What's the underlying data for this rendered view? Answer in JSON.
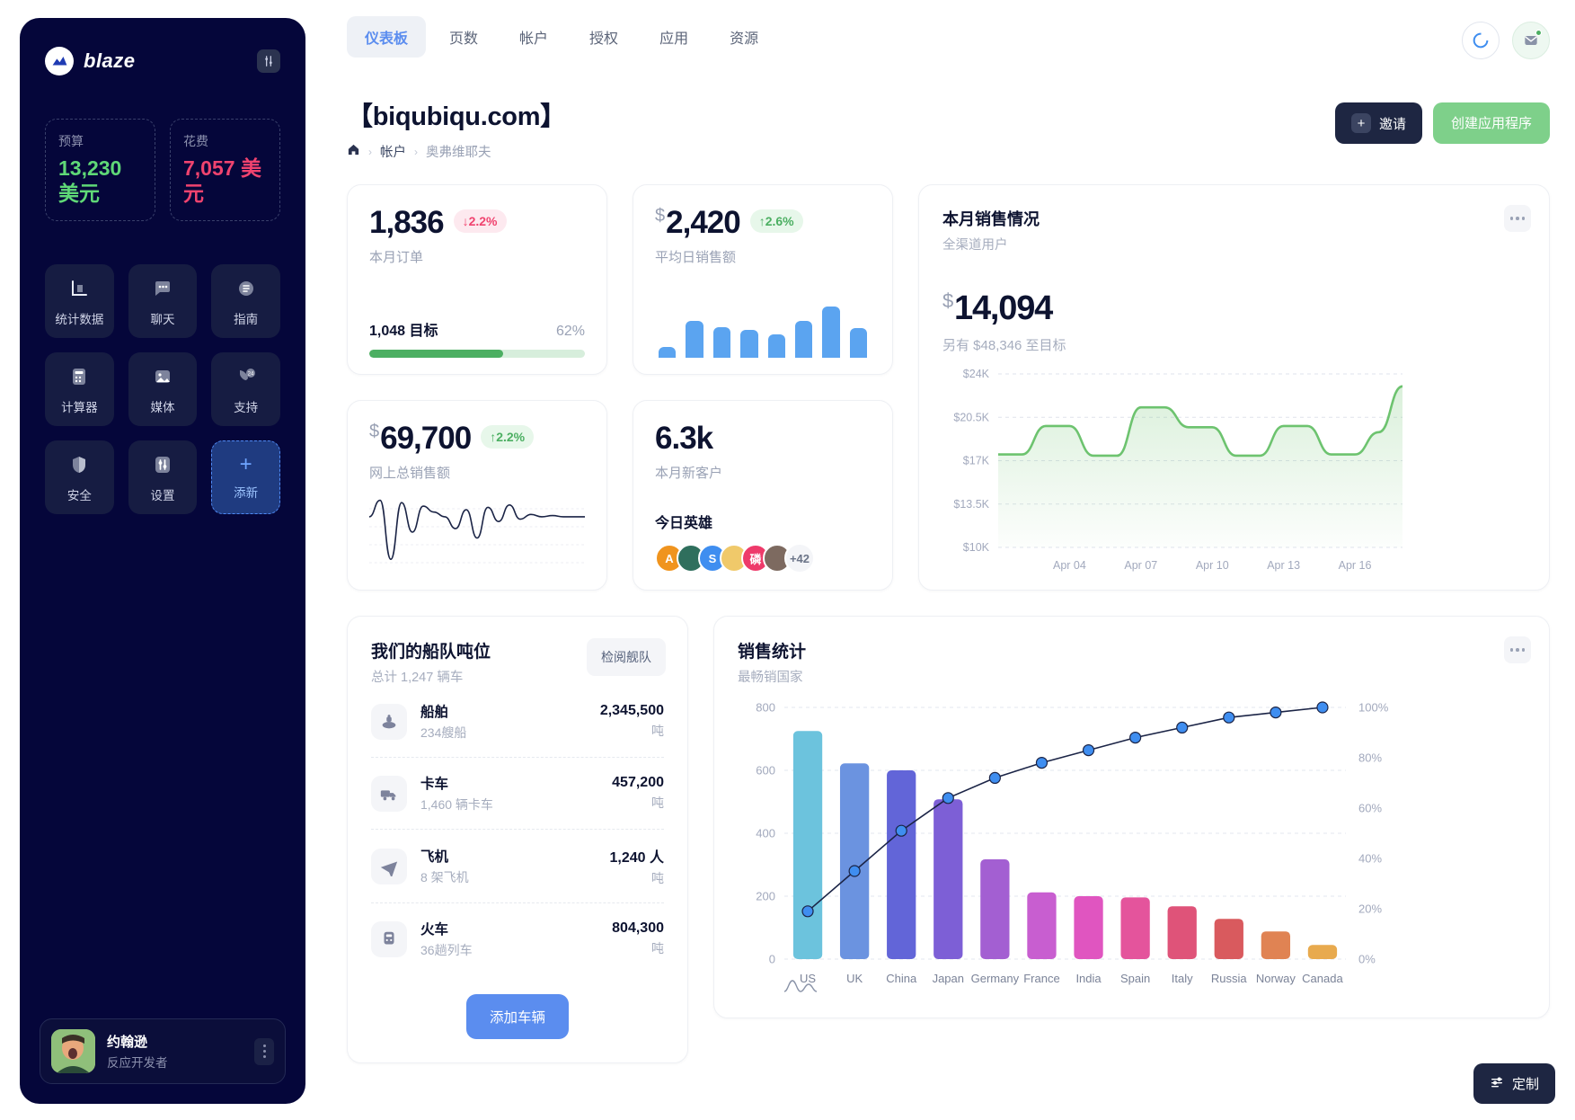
{
  "sidebar": {
    "brand": "blaze",
    "settings_icon": "sliders-icon",
    "budget": {
      "label": "预算",
      "value": "13,230 美元",
      "color": "#5fd877"
    },
    "spend": {
      "label": "花费",
      "value": "7,057 美元",
      "color": "#f0436f"
    },
    "nav": [
      {
        "label": "统计数据",
        "icon": "chart-icon"
      },
      {
        "label": "聊天",
        "icon": "chat-icon"
      },
      {
        "label": "指南",
        "icon": "guide-icon"
      },
      {
        "label": "计算器",
        "icon": "calculator-icon"
      },
      {
        "label": "媒体",
        "icon": "media-icon"
      },
      {
        "label": "支持",
        "icon": "support-24-icon"
      },
      {
        "label": "安全",
        "icon": "shield-icon"
      },
      {
        "label": "设置",
        "icon": "settings-icon"
      },
      {
        "label": "添新",
        "icon": "plus-icon"
      }
    ],
    "profile": {
      "name": "约翰逊",
      "role": "反应开发者"
    }
  },
  "header": {
    "tabs": [
      {
        "label": "仪表板",
        "active": true
      },
      {
        "label": "页数",
        "active": false
      },
      {
        "label": "帐户",
        "active": false
      },
      {
        "label": "授权",
        "active": false
      },
      {
        "label": "应用",
        "active": false
      },
      {
        "label": "资源",
        "active": false
      }
    ],
    "title": "【biqubiqu.com】",
    "breadcrumb": {
      "home": "home-icon",
      "level1": "帐户",
      "level2": "奥弗维耶夫"
    },
    "invite_button": "邀请",
    "create_button": "创建应用程序"
  },
  "cards": {
    "orders": {
      "value": "1,836",
      "change": "2.2%",
      "direction": "down",
      "subtitle": "本月订单",
      "goal_label": "1,048 目标",
      "goal_percent": "62%",
      "goal_fill": 62
    },
    "avg_daily": {
      "currency": "$",
      "value": "2,420",
      "change": "2.6%",
      "direction": "up",
      "subtitle": "平均日销售额"
    },
    "online_sales": {
      "currency": "$",
      "value": "69,700",
      "change": "2.2%",
      "direction": "up",
      "subtitle": "网上总销售额"
    },
    "new_customers": {
      "value": "6.3k",
      "subtitle": "本月新客户",
      "heroes_label": "今日英雄",
      "heroes": [
        {
          "initial": "A",
          "color": "#f0941e"
        },
        {
          "initial": "",
          "color": "#2f6f5d"
        },
        {
          "initial": "S",
          "color": "#3f8ef0"
        },
        {
          "initial": "",
          "color": "#f0c96a"
        },
        {
          "initial": "磷",
          "color": "#ee3a6a"
        },
        {
          "initial": "",
          "color": "#7d6a60"
        }
      ],
      "more": "+42"
    },
    "month_sales": {
      "title": "本月销售情况",
      "subtitle": "全渠道用户",
      "currency": "$",
      "value": "14,094",
      "note": "另有 $48,346 至目标"
    }
  },
  "fleet": {
    "title": "我们的船队吨位",
    "subtitle": "总计 1,247 辆车",
    "review_button": "检阅舰队",
    "add_button": "添加车辆",
    "rows": [
      {
        "name": "船舶",
        "count": "234艘船",
        "value": "2,345,500",
        "unit": "吨",
        "icon": "ship-icon"
      },
      {
        "name": "卡车",
        "count": "1,460 辆卡车",
        "value": "457,200",
        "unit": "吨",
        "icon": "truck-icon"
      },
      {
        "name": "飞机",
        "count": "8 架飞机",
        "value": "1,240 人",
        "unit": "吨",
        "icon": "plane-icon"
      },
      {
        "name": "火车",
        "count": "36趟列车",
        "value": "804,300",
        "unit": "吨",
        "icon": "train-icon"
      }
    ]
  },
  "sales_stats": {
    "title": "销售统计",
    "subtitle": "最畅销国家"
  },
  "footer": {
    "customize": "定制"
  },
  "chart_data": [
    {
      "type": "area",
      "title": "本月销售情况",
      "x": [
        "Apr 01",
        "Apr 02",
        "Apr 03",
        "Apr 04",
        "Apr 05",
        "Apr 06",
        "Apr 07",
        "Apr 08",
        "Apr 09",
        "Apr 10",
        "Apr 11",
        "Apr 12",
        "Apr 13",
        "Apr 14",
        "Apr 15",
        "Apr 16",
        "Apr 17",
        "Apr 18"
      ],
      "values": [
        17500,
        17500,
        19800,
        19800,
        17400,
        17400,
        21300,
        21300,
        19700,
        19700,
        17400,
        17400,
        19800,
        19800,
        17500,
        17500,
        19300,
        23000
      ],
      "tick_labels": [
        "Apr 04",
        "Apr 07",
        "Apr 10",
        "Apr 13",
        "Apr 16"
      ],
      "ylabels": [
        "$24K",
        "$20.5K",
        "$17K",
        "$13.5K",
        "$10K"
      ],
      "ylim": [
        10000,
        24000
      ],
      "color": "#6dc36f",
      "grid": true,
      "legend": "none"
    },
    {
      "type": "bar",
      "title": "销售统计",
      "subtitle": "最畅销国家",
      "categories": [
        "US",
        "UK",
        "China",
        "Japan",
        "Germany",
        "France",
        "India",
        "Spain",
        "Italy",
        "Russia",
        "Norway",
        "Canada"
      ],
      "values": [
        725,
        622,
        600,
        508,
        317,
        212,
        200,
        196,
        168,
        128,
        88,
        45
      ],
      "series": [
        {
          "name": "sales",
          "values": [
            725,
            622,
            600,
            508,
            317,
            212,
            200,
            196,
            168,
            128,
            88,
            45
          ]
        },
        {
          "name": "cumulative_percent",
          "values": [
            19,
            35,
            51,
            64,
            72,
            78,
            83,
            88,
            92,
            96,
            98,
            100
          ]
        }
      ],
      "ylabels": [
        "800",
        "600",
        "400",
        "200",
        "0"
      ],
      "ylim": [
        0,
        800
      ],
      "y2labels": [
        "100%",
        "80%",
        "60%",
        "40%",
        "20%",
        "0%"
      ],
      "y2lim": [
        0,
        100
      ],
      "bar_colors": [
        "#6cc3dd",
        "#6b93e0",
        "#6265d8",
        "#7d5fd6",
        "#a35fd2",
        "#c85ed0",
        "#e055c0",
        "#e4549c",
        "#df5379",
        "#d95a5e",
        "#e08353",
        "#e8aa4e"
      ],
      "line_color": "#1b2446",
      "marker_color": "#3f8ef0",
      "grid": true,
      "legend": "none"
    },
    {
      "type": "bar",
      "title": "平均日销售额",
      "categories": [
        "1",
        "2",
        "3",
        "4",
        "5",
        "6",
        "7",
        "8"
      ],
      "values": [
        14,
        48,
        40,
        36,
        30,
        48,
        66,
        38
      ],
      "color": "#5ba4f0",
      "ylim": [
        0,
        70
      ]
    },
    {
      "type": "line",
      "title": "网上总销售额",
      "x": [
        0,
        1,
        2,
        3,
        4,
        5,
        6,
        7,
        8,
        9,
        10,
        11,
        12,
        13,
        14,
        15,
        16,
        17,
        18,
        19,
        20
      ],
      "values": [
        48,
        62,
        12,
        60,
        35,
        57,
        52,
        48,
        38,
        54,
        30,
        56,
        44,
        58,
        46,
        50,
        48,
        49,
        48,
        48,
        48
      ],
      "color": "#1b2446",
      "ylim": [
        0,
        70
      ]
    }
  ]
}
